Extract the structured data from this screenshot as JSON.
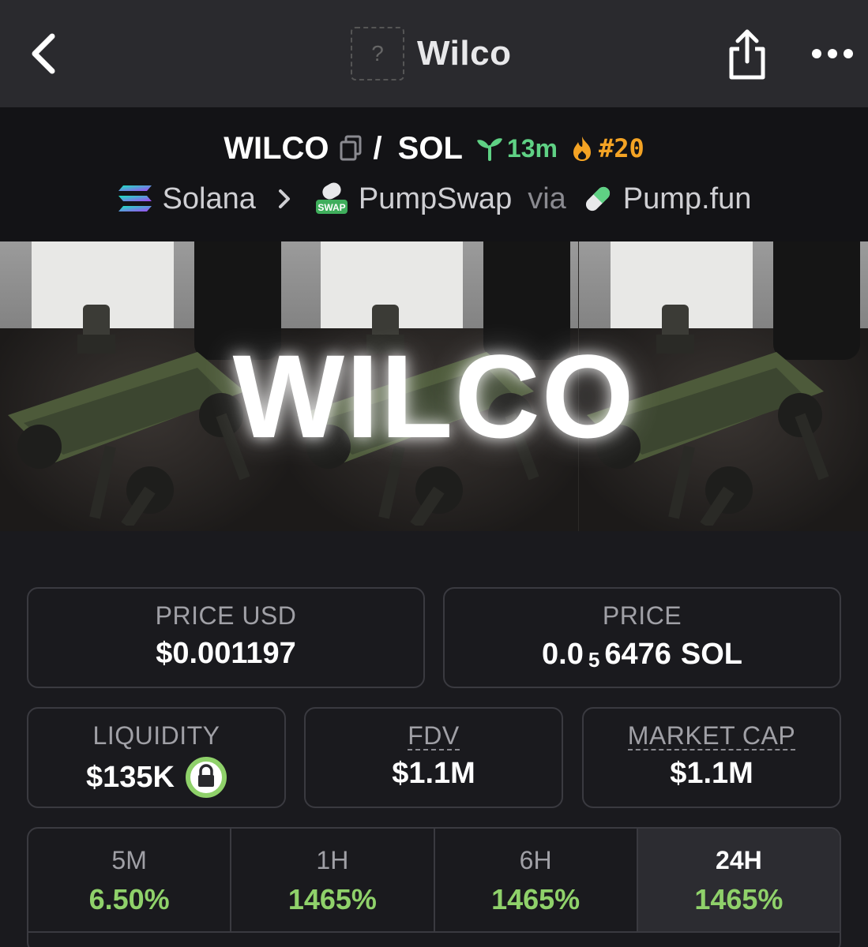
{
  "header": {
    "title": "Wilco",
    "logo_placeholder": "?",
    "icons": {
      "back": "chevron-left-icon",
      "share": "share-icon",
      "more": "more-icon"
    }
  },
  "pair": {
    "base": "WILCO",
    "separator": "/",
    "quote": "SOL",
    "age": "13m",
    "rank": "#20",
    "chain": "Solana",
    "dex": "PumpSwap",
    "via_label": "via",
    "launchpad": "Pump.fun",
    "colors": {
      "age": "#5fd184",
      "rank": "#f4a324"
    }
  },
  "banner": {
    "text": "WILCO"
  },
  "stats": {
    "price_usd": {
      "label": "PRICE USD",
      "value": "$0.001197"
    },
    "price_native": {
      "label": "PRICE",
      "prefix": "0.0",
      "sub_zeros": "5",
      "digits": "6476",
      "unit": "SOL"
    },
    "liquidity": {
      "label": "LIQUIDITY",
      "value": "$135K"
    },
    "fdv": {
      "label": "FDV",
      "value": "$1.1M"
    },
    "market_cap": {
      "label": "MARKET CAP",
      "value": "$1.1M"
    }
  },
  "timeframes": [
    {
      "label": "5M",
      "value": "6.50%"
    },
    {
      "label": "1H",
      "value": "1465%"
    },
    {
      "label": "6H",
      "value": "1465%"
    },
    {
      "label": "24H",
      "value": "1465%",
      "active": true
    }
  ],
  "colors": {
    "positive": "#8fd16a",
    "background": "#1a1a1e",
    "topbar": "#2a2a2e"
  }
}
